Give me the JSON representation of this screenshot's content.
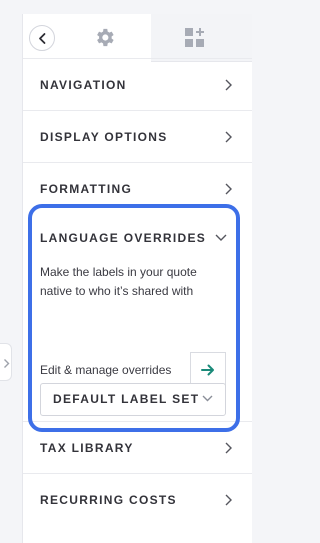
{
  "panel": {
    "tabs": [
      {
        "icon": "gear-icon",
        "active": true
      },
      {
        "icon": "widgets-icon",
        "active": false
      }
    ],
    "sections": [
      {
        "label": "NAVIGATION"
      },
      {
        "label": "DISPLAY OPTIONS"
      },
      {
        "label": "FORMATTING"
      }
    ],
    "language_overrides": {
      "title": "LANGUAGE OVERRIDES",
      "description": "Make the labels in your quote native to who it’s shared with",
      "edit_label": "Edit & manage overrides",
      "select_value": "DEFAULT LABEL SET"
    },
    "sections_after": [
      {
        "label": "TAX LIBRARY"
      },
      {
        "label": "RECURRING COSTS"
      }
    ]
  },
  "colors": {
    "accent_arrow": "#1a8a79",
    "highlight_border": "#3d6fe8",
    "icon_gray": "#a7abb5"
  }
}
